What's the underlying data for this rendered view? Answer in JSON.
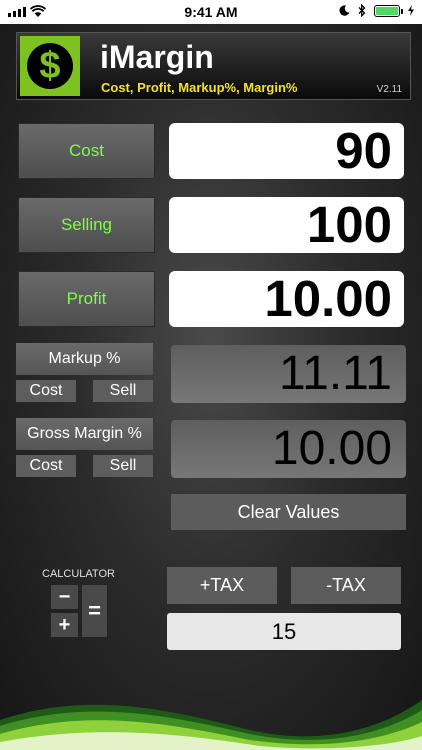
{
  "status_bar": {
    "time": "9:41 AM",
    "battery_level": 1.0
  },
  "header": {
    "title": "iMargin",
    "subtitle": "Cost, Profit, Markup%, Margin%",
    "version": "V2.11",
    "logo_symbol": "$"
  },
  "inputs": [
    {
      "label": "Cost",
      "value": "90"
    },
    {
      "label": "Selling",
      "value": "100"
    },
    {
      "label": "Profit",
      "value": "10.00"
    }
  ],
  "markup": {
    "label": "Markup %",
    "cost_label": "Cost",
    "sell_label": "Sell",
    "value": "11.11"
  },
  "margin": {
    "label": "Gross Margin %",
    "cost_label": "Cost",
    "sell_label": "Sell",
    "value": "10.00"
  },
  "clear_label": "Clear Values",
  "calculator": {
    "label": "CALCULATOR",
    "keys": {
      "minus": "−",
      "plus": "+",
      "equals": "="
    }
  },
  "tax": {
    "plus_label": "+TAX",
    "minus_label": "-TAX",
    "rate": "15"
  },
  "colors": {
    "accent_green": "#7cff45",
    "logo_green": "#7ec21f",
    "subtitle_yellow": "#f2e32a"
  },
  "icons": [
    "cellular-signal-icon",
    "wifi-icon",
    "moon-icon",
    "bluetooth-icon",
    "battery-icon",
    "dollar-logo-icon",
    "calculator-icon"
  ]
}
